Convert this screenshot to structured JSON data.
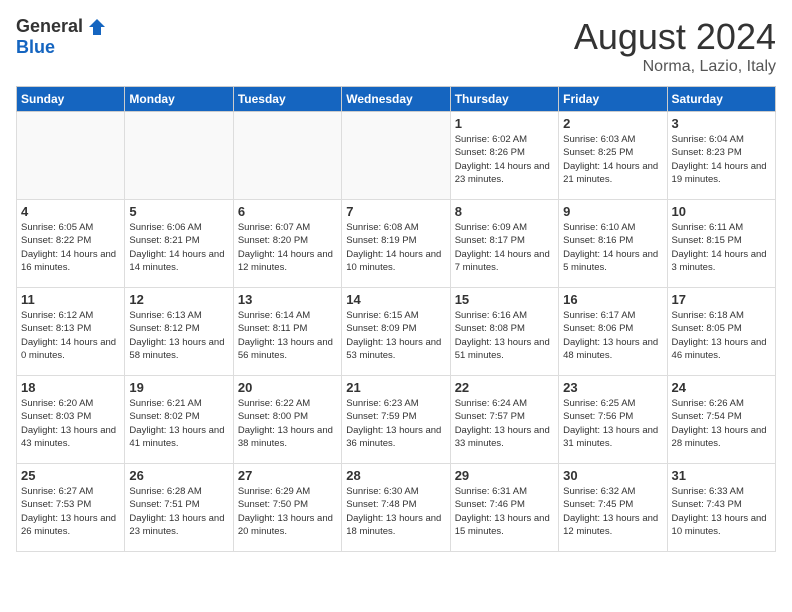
{
  "header": {
    "logo_general": "General",
    "logo_blue": "Blue",
    "title": "August 2024",
    "subtitle": "Norma, Lazio, Italy"
  },
  "weekdays": [
    "Sunday",
    "Monday",
    "Tuesday",
    "Wednesday",
    "Thursday",
    "Friday",
    "Saturday"
  ],
  "weeks": [
    [
      {
        "day": "",
        "info": ""
      },
      {
        "day": "",
        "info": ""
      },
      {
        "day": "",
        "info": ""
      },
      {
        "day": "",
        "info": ""
      },
      {
        "day": "1",
        "info": "Sunrise: 6:02 AM\nSunset: 8:26 PM\nDaylight: 14 hours\nand 23 minutes."
      },
      {
        "day": "2",
        "info": "Sunrise: 6:03 AM\nSunset: 8:25 PM\nDaylight: 14 hours\nand 21 minutes."
      },
      {
        "day": "3",
        "info": "Sunrise: 6:04 AM\nSunset: 8:23 PM\nDaylight: 14 hours\nand 19 minutes."
      }
    ],
    [
      {
        "day": "4",
        "info": "Sunrise: 6:05 AM\nSunset: 8:22 PM\nDaylight: 14 hours\nand 16 minutes."
      },
      {
        "day": "5",
        "info": "Sunrise: 6:06 AM\nSunset: 8:21 PM\nDaylight: 14 hours\nand 14 minutes."
      },
      {
        "day": "6",
        "info": "Sunrise: 6:07 AM\nSunset: 8:20 PM\nDaylight: 14 hours\nand 12 minutes."
      },
      {
        "day": "7",
        "info": "Sunrise: 6:08 AM\nSunset: 8:19 PM\nDaylight: 14 hours\nand 10 minutes."
      },
      {
        "day": "8",
        "info": "Sunrise: 6:09 AM\nSunset: 8:17 PM\nDaylight: 14 hours\nand 7 minutes."
      },
      {
        "day": "9",
        "info": "Sunrise: 6:10 AM\nSunset: 8:16 PM\nDaylight: 14 hours\nand 5 minutes."
      },
      {
        "day": "10",
        "info": "Sunrise: 6:11 AM\nSunset: 8:15 PM\nDaylight: 14 hours\nand 3 minutes."
      }
    ],
    [
      {
        "day": "11",
        "info": "Sunrise: 6:12 AM\nSunset: 8:13 PM\nDaylight: 14 hours\nand 0 minutes."
      },
      {
        "day": "12",
        "info": "Sunrise: 6:13 AM\nSunset: 8:12 PM\nDaylight: 13 hours\nand 58 minutes."
      },
      {
        "day": "13",
        "info": "Sunrise: 6:14 AM\nSunset: 8:11 PM\nDaylight: 13 hours\nand 56 minutes."
      },
      {
        "day": "14",
        "info": "Sunrise: 6:15 AM\nSunset: 8:09 PM\nDaylight: 13 hours\nand 53 minutes."
      },
      {
        "day": "15",
        "info": "Sunrise: 6:16 AM\nSunset: 8:08 PM\nDaylight: 13 hours\nand 51 minutes."
      },
      {
        "day": "16",
        "info": "Sunrise: 6:17 AM\nSunset: 8:06 PM\nDaylight: 13 hours\nand 48 minutes."
      },
      {
        "day": "17",
        "info": "Sunrise: 6:18 AM\nSunset: 8:05 PM\nDaylight: 13 hours\nand 46 minutes."
      }
    ],
    [
      {
        "day": "18",
        "info": "Sunrise: 6:20 AM\nSunset: 8:03 PM\nDaylight: 13 hours\nand 43 minutes."
      },
      {
        "day": "19",
        "info": "Sunrise: 6:21 AM\nSunset: 8:02 PM\nDaylight: 13 hours\nand 41 minutes."
      },
      {
        "day": "20",
        "info": "Sunrise: 6:22 AM\nSunset: 8:00 PM\nDaylight: 13 hours\nand 38 minutes."
      },
      {
        "day": "21",
        "info": "Sunrise: 6:23 AM\nSunset: 7:59 PM\nDaylight: 13 hours\nand 36 minutes."
      },
      {
        "day": "22",
        "info": "Sunrise: 6:24 AM\nSunset: 7:57 PM\nDaylight: 13 hours\nand 33 minutes."
      },
      {
        "day": "23",
        "info": "Sunrise: 6:25 AM\nSunset: 7:56 PM\nDaylight: 13 hours\nand 31 minutes."
      },
      {
        "day": "24",
        "info": "Sunrise: 6:26 AM\nSunset: 7:54 PM\nDaylight: 13 hours\nand 28 minutes."
      }
    ],
    [
      {
        "day": "25",
        "info": "Sunrise: 6:27 AM\nSunset: 7:53 PM\nDaylight: 13 hours\nand 26 minutes."
      },
      {
        "day": "26",
        "info": "Sunrise: 6:28 AM\nSunset: 7:51 PM\nDaylight: 13 hours\nand 23 minutes."
      },
      {
        "day": "27",
        "info": "Sunrise: 6:29 AM\nSunset: 7:50 PM\nDaylight: 13 hours\nand 20 minutes."
      },
      {
        "day": "28",
        "info": "Sunrise: 6:30 AM\nSunset: 7:48 PM\nDaylight: 13 hours\nand 18 minutes."
      },
      {
        "day": "29",
        "info": "Sunrise: 6:31 AM\nSunset: 7:46 PM\nDaylight: 13 hours\nand 15 minutes."
      },
      {
        "day": "30",
        "info": "Sunrise: 6:32 AM\nSunset: 7:45 PM\nDaylight: 13 hours\nand 12 minutes."
      },
      {
        "day": "31",
        "info": "Sunrise: 6:33 AM\nSunset: 7:43 PM\nDaylight: 13 hours\nand 10 minutes."
      }
    ]
  ]
}
